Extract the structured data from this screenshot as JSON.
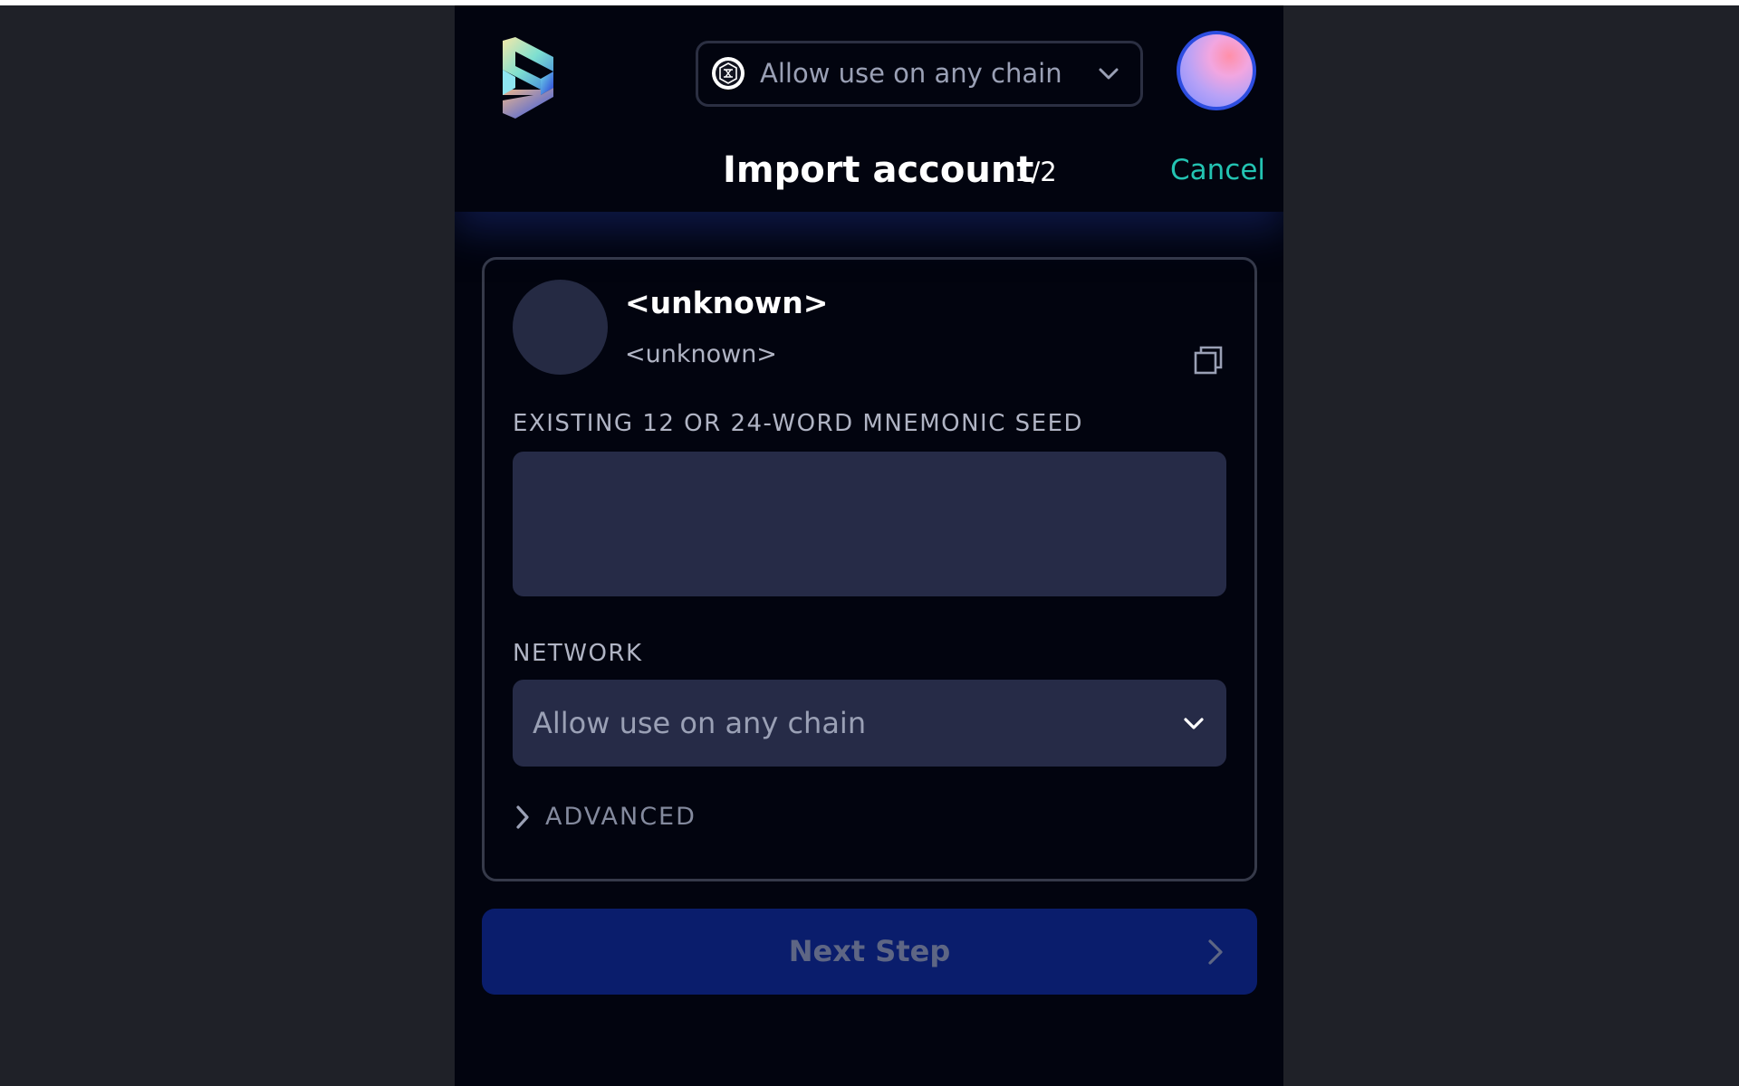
{
  "header": {
    "chain_selector": {
      "value": "Allow use on any chain",
      "icon": "chain-globe-icon"
    },
    "title": "Import account",
    "step": "1/2",
    "cancel_label": "Cancel"
  },
  "account": {
    "name": "<unknown>",
    "address": "<unknown>"
  },
  "seed": {
    "label": "EXISTING 12 OR 24-WORD MNEMONIC SEED",
    "value": ""
  },
  "network": {
    "label": "NETWORK",
    "selected": "Allow use on any chain"
  },
  "advanced_label": "ADVANCED",
  "next_button_label": "Next Step",
  "colors": {
    "background": "#1f2128",
    "popup": "#02040f",
    "accent_cancel": "#23c3b2",
    "input_bg": "#262b47",
    "primary_button_disabled": "#0a1d6c"
  }
}
